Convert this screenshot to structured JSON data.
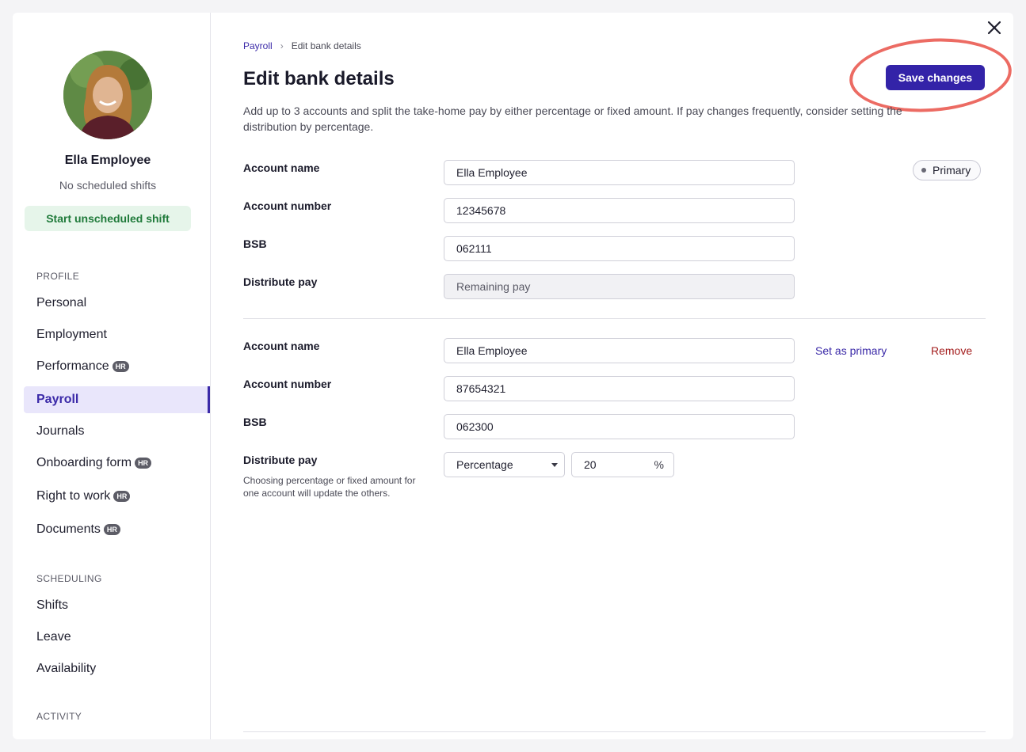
{
  "sidebar": {
    "employee_name": "Ella Employee",
    "shift_status": "No scheduled shifts",
    "start_shift_label": "Start unscheduled shift",
    "sections": {
      "profile": "PROFILE",
      "scheduling": "SCHEDULING",
      "activity": "ACTIVITY"
    },
    "profile_items": [
      {
        "label": "Personal",
        "hr": false
      },
      {
        "label": "Employment",
        "hr": false
      },
      {
        "label": "Performance",
        "hr": true
      },
      {
        "label": "Payroll",
        "hr": false,
        "active": true
      },
      {
        "label": "Journals",
        "hr": false
      },
      {
        "label": "Onboarding form",
        "hr": true
      },
      {
        "label": "Right to work",
        "hr": true
      },
      {
        "label": "Documents",
        "hr": true
      }
    ],
    "scheduling_items": [
      {
        "label": "Shifts"
      },
      {
        "label": "Leave"
      },
      {
        "label": "Availability"
      }
    ],
    "hr_badge": "HR"
  },
  "breadcrumb": {
    "parent": "Payroll",
    "current": "Edit bank details"
  },
  "page": {
    "title": "Edit bank details",
    "save_label": "Save changes",
    "description": "Add up to 3 accounts and split the take-home pay by either percentage or fixed amount. If pay changes frequently, consider setting the distribution by percentage."
  },
  "labels": {
    "account_name": "Account name",
    "account_number": "Account number",
    "bsb": "BSB",
    "distribute_pay": "Distribute pay",
    "distribute_hint": "Choosing percentage or fixed amount for one account will update the others."
  },
  "account1": {
    "account_name": "Ella Employee",
    "account_number": "12345678",
    "bsb": "062111",
    "distribute_pay": "Remaining pay",
    "badge": "Primary"
  },
  "account2": {
    "account_name": "Ella Employee",
    "account_number": "87654321",
    "bsb": "062300",
    "distribute_mode": "Percentage",
    "distribute_value": "20",
    "distribute_unit": "%",
    "set_primary_label": "Set as primary",
    "remove_label": "Remove"
  },
  "colors": {
    "accent": "#3323a8",
    "highlight": "#ec6b63",
    "success": "#1f7a3a",
    "danger": "#a31c1c"
  }
}
